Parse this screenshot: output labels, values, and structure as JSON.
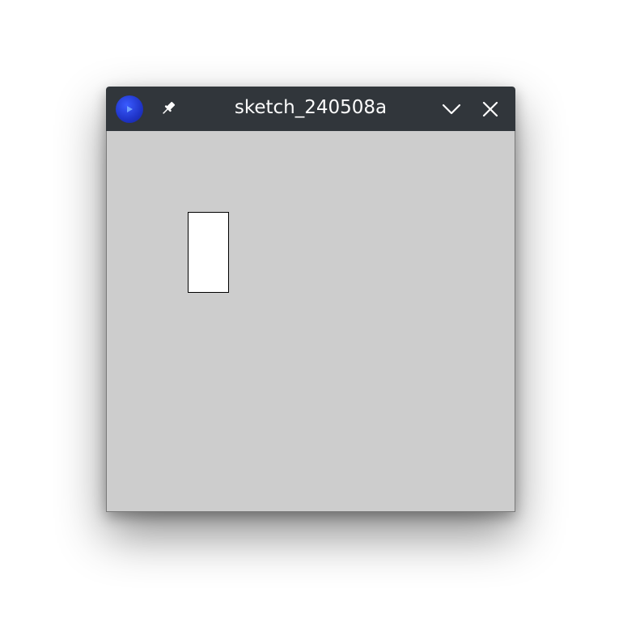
{
  "window": {
    "title": "sketch_240508a",
    "icons": {
      "app": "processing-app-icon",
      "pin": "pin-icon",
      "minimize": "chevron-down-icon",
      "close": "close-icon"
    },
    "colors": {
      "titlebar": "#31363b",
      "title_text": "#fcfcfc",
      "canvas_background": "#cdcdcd",
      "shape_fill": "#ffffff",
      "shape_stroke": "#000000",
      "app_icon_blue": "#1f34c8"
    }
  }
}
